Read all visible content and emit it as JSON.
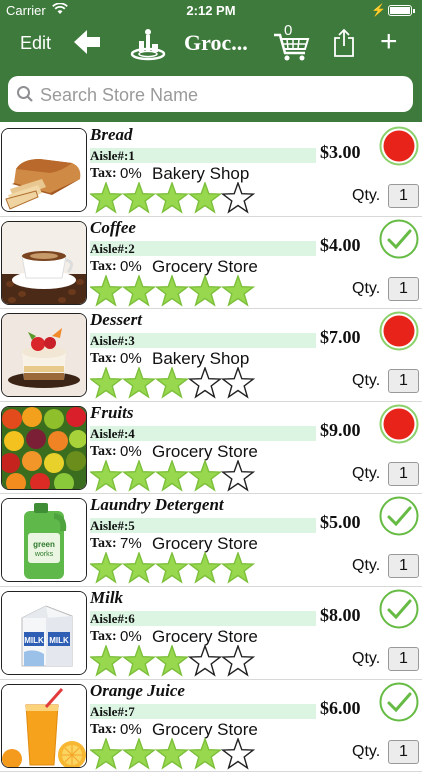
{
  "status_bar": {
    "carrier": "Carrier",
    "time": "2:12 PM"
  },
  "nav": {
    "edit_label": "Edit",
    "title": "Groc...",
    "cart_count": "0"
  },
  "search": {
    "placeholder": "Search Store Name"
  },
  "icons": [
    "signal-wifi-icon",
    "battery-icon",
    "back-arrow-icon",
    "store-icon",
    "cart-icon",
    "share-icon",
    "plus-icon",
    "search-icon",
    "red-circle-icon",
    "checkmark-icon",
    "star-icon"
  ],
  "colors": {
    "nav_bg": "#3e7a3c",
    "aisle_bg": "#dbf5e2",
    "star_fill": "#98d84f",
    "red_status": "#e8241a",
    "check_green": "#66bb44"
  },
  "items": [
    {
      "name": "Bread",
      "aisle": "Aisle#:1",
      "price": "$3.00",
      "tax_label": "Tax:",
      "tax": "0%",
      "store": "Bakery Shop",
      "rating": 4,
      "status": "red",
      "qty_label": "Qty.",
      "qty": "1",
      "image": "bread"
    },
    {
      "name": "Coffee",
      "aisle": "Aisle#:2",
      "price": "$4.00",
      "tax_label": "Tax:",
      "tax": "0%",
      "store": "Grocery Store",
      "rating": 5,
      "status": "check",
      "qty_label": "Qty.",
      "qty": "1",
      "image": "coffee"
    },
    {
      "name": "Dessert",
      "aisle": "Aisle#:3",
      "price": "$7.00",
      "tax_label": "Tax:",
      "tax": "0%",
      "store": "Bakery Shop",
      "rating": 3,
      "status": "red",
      "qty_label": "Qty.",
      "qty": "1",
      "image": "dessert"
    },
    {
      "name": "Fruits",
      "aisle": "Aisle#:4",
      "price": "$9.00",
      "tax_label": "Tax:",
      "tax": "0%",
      "store": "Grocery Store",
      "rating": 4,
      "status": "red",
      "qty_label": "Qty.",
      "qty": "1",
      "image": "fruits"
    },
    {
      "name": "Laundry Detergent",
      "aisle": "Aisle#:5",
      "price": "$5.00",
      "tax_label": "Tax:",
      "tax": "7%",
      "store": "Grocery Store",
      "rating": 5,
      "status": "check",
      "qty_label": "Qty.",
      "qty": "1",
      "image": "detergent"
    },
    {
      "name": "Milk",
      "aisle": "Aisle#:6",
      "price": "$8.00",
      "tax_label": "Tax:",
      "tax": "0%",
      "store": "Grocery Store",
      "rating": 3,
      "status": "check",
      "qty_label": "Qty.",
      "qty": "1",
      "image": "milk"
    },
    {
      "name": "Orange Juice",
      "aisle": "Aisle#:7",
      "price": "$6.00",
      "tax_label": "Tax:",
      "tax": "0%",
      "store": "Grocery Store",
      "rating": 4,
      "status": "check",
      "qty_label": "Qty.",
      "qty": "1",
      "image": "juice"
    }
  ]
}
